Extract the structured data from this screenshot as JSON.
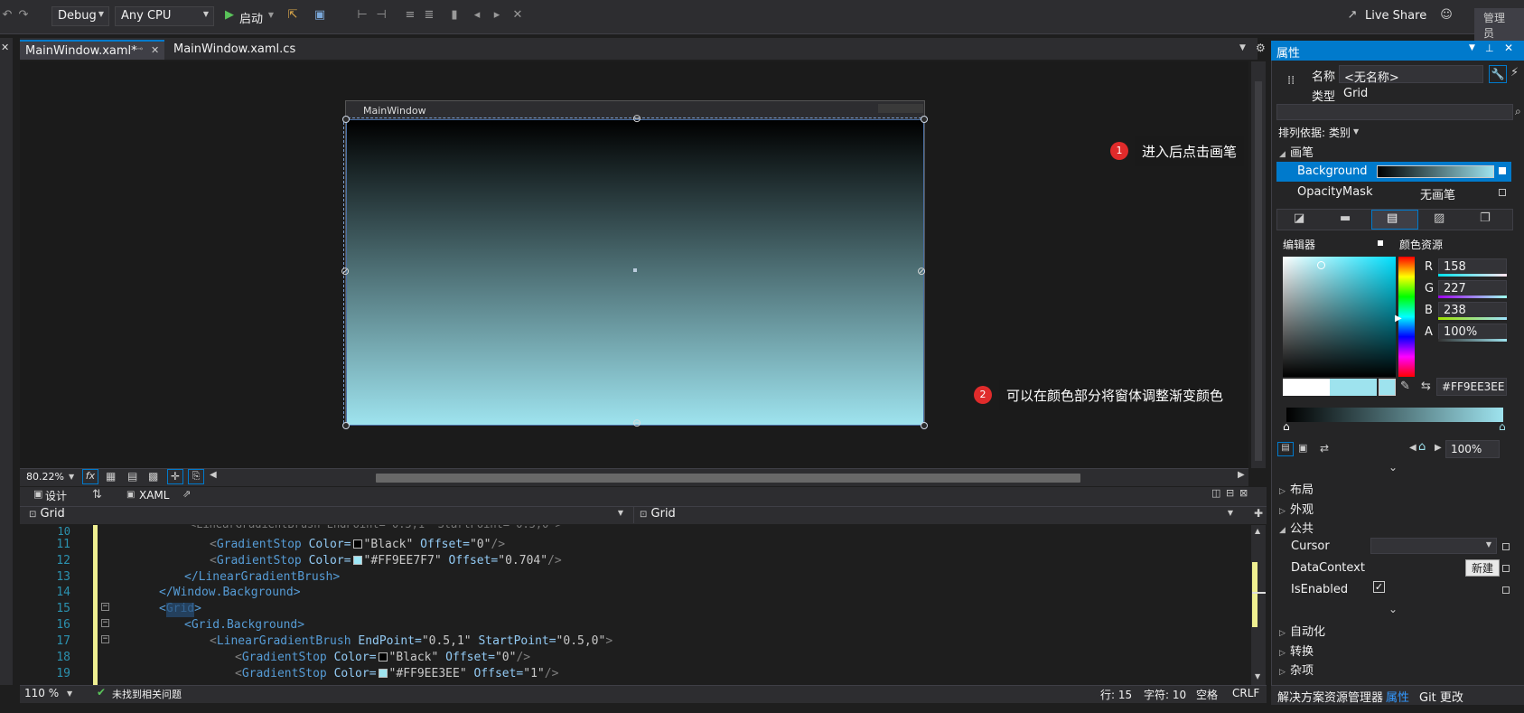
{
  "toolbar": {
    "config": "Debug",
    "platform": "Any CPU",
    "start_label": "启动",
    "live_share": "Live Share",
    "admin": "管理员"
  },
  "tabs": [
    {
      "label": "MainWindow.xaml*",
      "active": true
    },
    {
      "label": "MainWindow.xaml.cs",
      "active": false
    }
  ],
  "designer": {
    "window_title": "MainWindow",
    "zoom": "80.22%",
    "gradient": {
      "start": "#000000",
      "end": "#9EE3EE"
    }
  },
  "callouts": [
    {
      "num": "1",
      "text": "进入后点击画笔"
    },
    {
      "num": "2",
      "text": "可以在颜色部分将窗体调整渐变颜色"
    }
  ],
  "split": {
    "design_tab": "设计",
    "swap": "⇅",
    "xaml_tab": "XAML"
  },
  "path": {
    "left": "Grid",
    "right": "Grid"
  },
  "code": {
    "line_numbers": [
      "11",
      "12",
      "13",
      "14",
      "15",
      "16",
      "17",
      "18",
      "19"
    ],
    "lines": [
      {
        "tag_open": "<",
        "tag": "GradientStop",
        "attr1": " Color=",
        "val1": "\"Black\"",
        "attr2": " Offset=",
        "val2": "\"0\"",
        "tag_close": "/>",
        "swatch": "#000000"
      },
      {
        "tag_open": "<",
        "tag": "GradientStop",
        "attr1": " Color=",
        "val1": "\"#FF9EE7F7\"",
        "attr2": " Offset=",
        "val2": "\"0.704\"",
        "tag_close": "/>",
        "swatch": "#9EE7F7"
      },
      {
        "text": "</LinearGradientBrush>"
      },
      {
        "text": "</Window.Background>"
      },
      {
        "text": "<Grid>"
      },
      {
        "text": "<Grid.Background>"
      },
      {
        "tag_open": "<",
        "tag": "LinearGradientBrush",
        "attr1": " EndPoint=",
        "val1": "\"0.5,1\"",
        "attr2": " StartPoint=",
        "val2": "\"0.5,0\"",
        "tag_close": ">"
      },
      {
        "tag_open": "<",
        "tag": "GradientStop",
        "attr1": " Color=",
        "val1": "\"Black\"",
        "attr2": " Offset=",
        "val2": "\"0\"",
        "tag_close": "/>",
        "swatch": "#000000"
      },
      {
        "tag_open": "<",
        "tag": "GradientStop",
        "attr1": " Color=",
        "val1": "\"#FF9EE3EE\"",
        "attr2": " Offset=",
        "val2": "\"1\"",
        "tag_close": "/>",
        "swatch": "#9EE3EE"
      }
    ]
  },
  "status": {
    "zoom": "110 %",
    "issues": "未找到相关问题",
    "line": "行: 15",
    "char": "字符: 10",
    "spacing": "空格",
    "eol": "CRLF"
  },
  "properties": {
    "title": "属性",
    "name_label": "名称",
    "name_value": "<无名称>",
    "type_label": "类型",
    "type_value": "Grid",
    "sort_by": "排列依据: 类别",
    "brush_section": "画笔",
    "background_label": "Background",
    "opacity_label": "OpacityMask",
    "opacity_value": "无画笔",
    "editor_label": "编辑器",
    "color_resources": "颜色资源",
    "r": "158",
    "g": "227",
    "b": "238",
    "a": "100%",
    "hex": "#FF9EE3EE",
    "stop_pct": "100%",
    "sec_layout": "布局",
    "sec_appearance": "外观",
    "sec_common": "公共",
    "cursor_label": "Cursor",
    "datacontext_label": "DataContext",
    "new_button": "新建",
    "isenabled_label": "IsEnabled",
    "sec_automation": "自动化",
    "sec_transform": "转换",
    "sec_misc": "杂项"
  },
  "bottom_tabs": [
    "解决方案资源管理器",
    "属性",
    "Git 更改"
  ]
}
